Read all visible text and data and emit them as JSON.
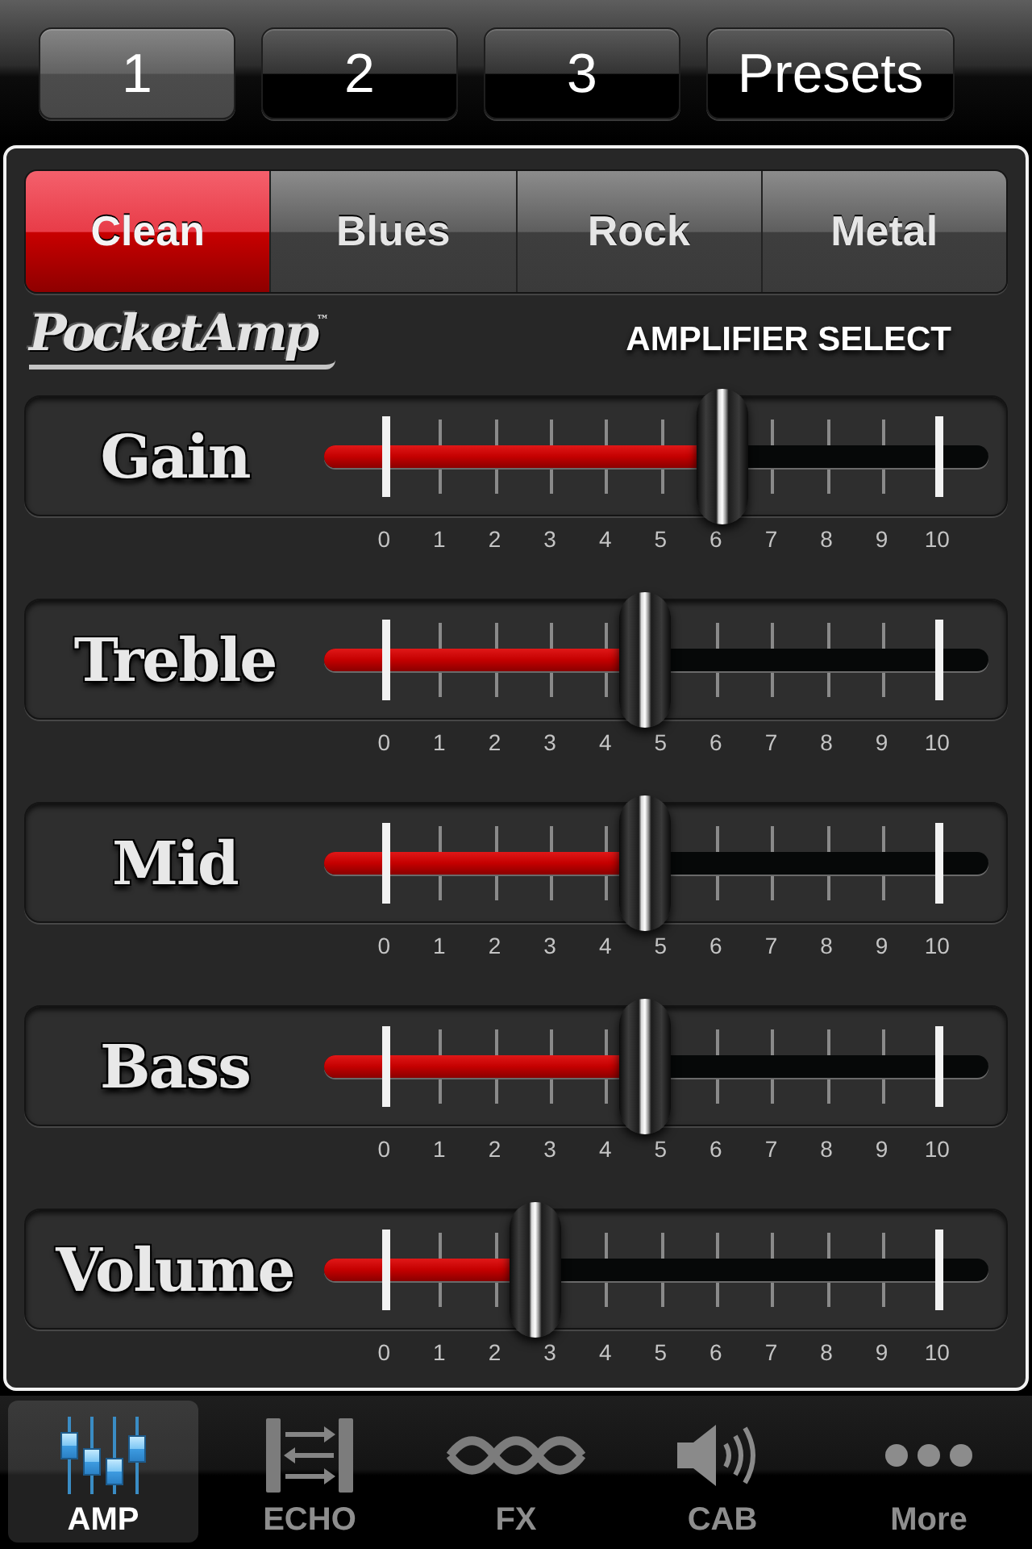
{
  "presets_bar": {
    "slots": [
      {
        "label": "1",
        "selected": true
      },
      {
        "label": "2",
        "selected": false
      },
      {
        "label": "3",
        "selected": false
      }
    ],
    "presets_button": "Presets"
  },
  "amp_select": {
    "amps": [
      {
        "label": "Clean",
        "selected": true
      },
      {
        "label": "Blues",
        "selected": false
      },
      {
        "label": "Rock",
        "selected": false
      },
      {
        "label": "Metal",
        "selected": false
      }
    ],
    "logo": "PocketAmp$^{™}$",
    "title": "AMPLIFIER SELECT"
  },
  "controls": [
    {
      "name": "Gain",
      "level": 0.61,
      "scale": [
        "0",
        "1",
        "2",
        "3",
        "4",
        "5",
        "6",
        "7",
        "8",
        "9",
        "10"
      ]
    },
    {
      "name": "Treble",
      "level": 0.47,
      "scale": [
        "0",
        "1",
        "2",
        "3",
        "4",
        "5",
        "6",
        "7",
        "8",
        "9",
        "10"
      ]
    },
    {
      "name": "Mid",
      "level": 0.47,
      "scale": [
        "0",
        "1",
        "2",
        "3",
        "4",
        "5",
        "6",
        "7",
        "8",
        "9",
        "10"
      ]
    },
    {
      "name": "Bass",
      "level": 0.47,
      "scale": [
        "0",
        "1",
        "2",
        "3",
        "4",
        "5",
        "6",
        "7",
        "8",
        "9",
        "10"
      ]
    },
    {
      "name": "Volume",
      "level": 0.27,
      "scale": [
        "0",
        "1",
        "2",
        "3",
        "4",
        "5",
        "6",
        "7",
        "8",
        "9",
        "10"
      ]
    }
  ],
  "tab_bar": [
    {
      "kind": "amp",
      "label": "AMP",
      "selected": true
    },
    {
      "kind": "echo",
      "label": "ECHO",
      "selected": false
    },
    {
      "kind": "fx",
      "label": "FX",
      "selected": false
    },
    {
      "kind": "cab",
      "label": "CAB",
      "selected": false
    },
    {
      "kind": "more",
      "label": "More",
      "selected": false
    }
  ]
}
